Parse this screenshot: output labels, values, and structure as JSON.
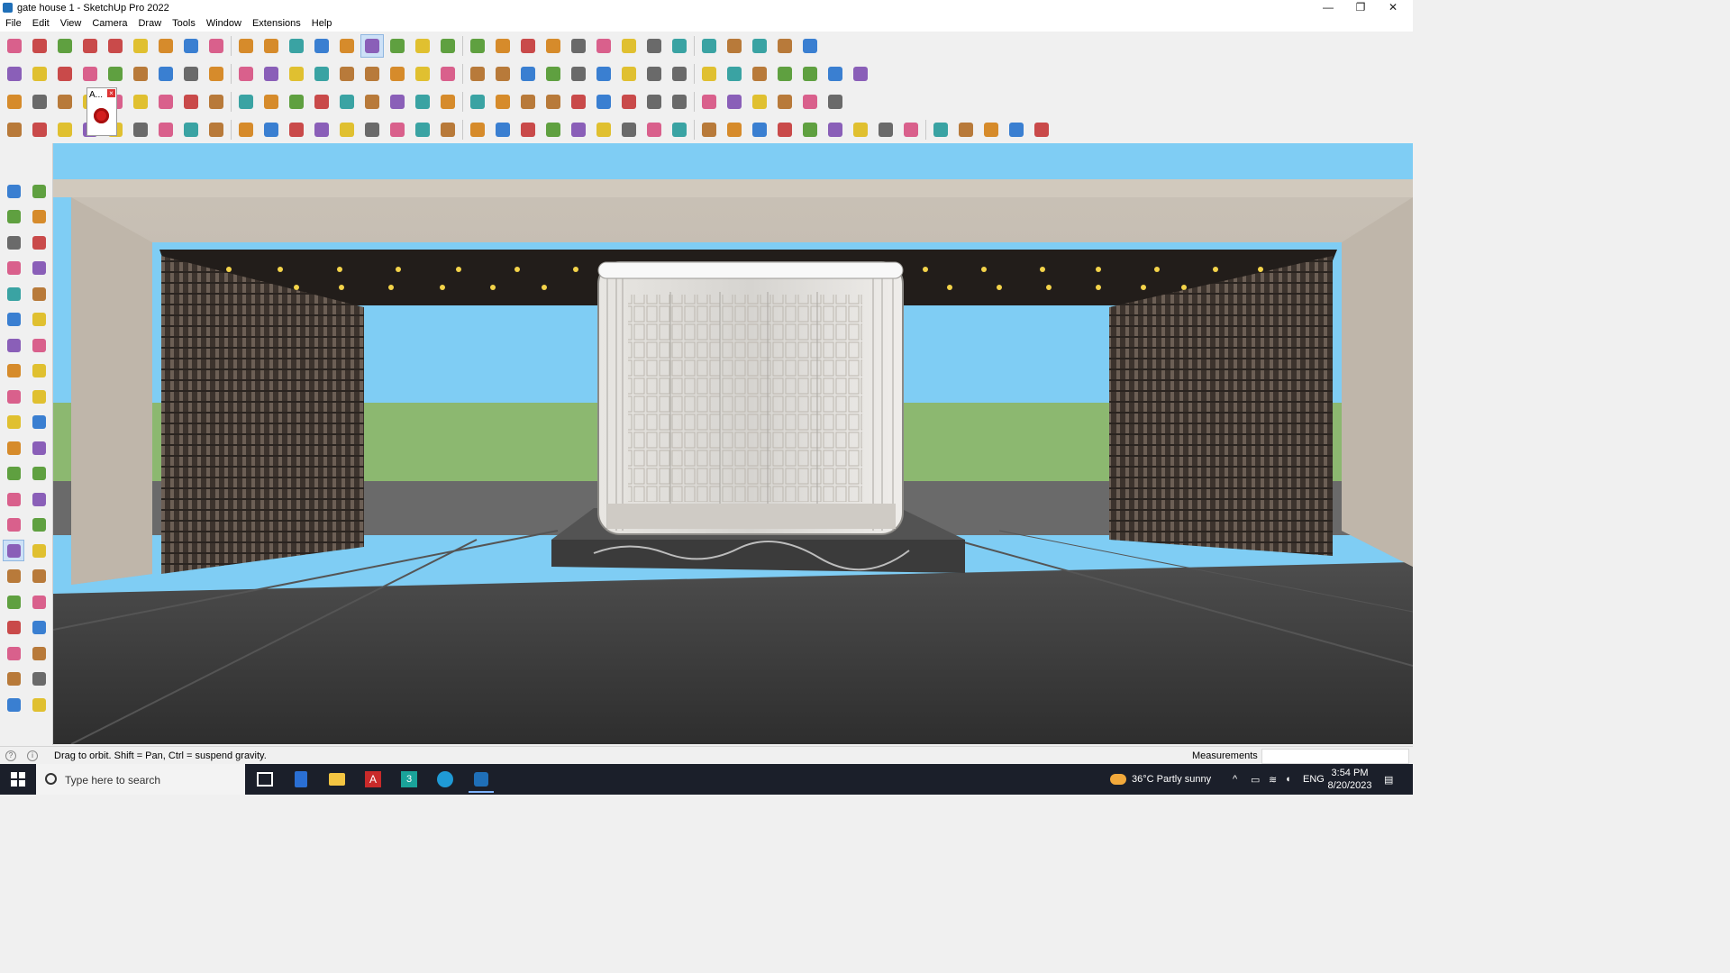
{
  "window": {
    "title": "gate house 1 - SketchUp Pro 2022",
    "controls": [
      "—",
      "❐",
      "✕"
    ]
  },
  "menu": [
    "File",
    "Edit",
    "View",
    "Camera",
    "Draw",
    "Tools",
    "Window",
    "Extensions",
    "Help"
  ],
  "toolbars": {
    "row1": [
      "zoom-extents-icon",
      "select-icon",
      "eraser-icon",
      "line-icon",
      "arc-icon",
      "shape-icon",
      "push-pull-icon",
      "follow-me-icon",
      "move-icon",
      "rotate-icon",
      "scale-icon",
      "tape-measure-icon",
      "text-icon",
      "paint-bucket-icon",
      "orbit-icon",
      "pan-icon",
      "zoom-icon",
      "zoom-window-icon",
      "model-info-icon",
      "layers-icon",
      "sandbox-icon",
      "tags-icon",
      "warehouse-icon",
      "extension-warehouse-icon",
      "layout-icon",
      "scenes-icon",
      "section-icon",
      "shadow-icon",
      "styles-icon",
      "undo-icon",
      "redo-icon",
      "print-icon"
    ],
    "row2": [
      "component-icon",
      "materials-icon",
      "solid-icon",
      "push-pull-icon",
      "axes-icon",
      "dimension-icon",
      "protractor-icon",
      "text-icon",
      "3d-text-icon",
      "section-plane-icon",
      "views-iso-icon",
      "views-top-icon",
      "views-front-icon",
      "views-right-icon",
      "views-back-icon",
      "views-left-icon",
      "standard-views-icon",
      "curve-icon",
      "offset-icon",
      "shape-icon",
      "circle-icon",
      "polygon-icon",
      "rectangle-icon",
      "arc-icon",
      "bezier-icon",
      "pencil-icon",
      "paint-icon",
      "tag-icon",
      "ruler-icon",
      "color-icon",
      "material-icon",
      "terrain-icon",
      "grid-icon",
      "plugin-icon"
    ],
    "row3": [
      "layer-icon",
      "layer-blue-icon",
      "layer-yellow-icon",
      "active-tool-popup-icon",
      "tool-red-icon",
      "fence-icon",
      "rotate-icon",
      "square-red-icon",
      "window-icon",
      "door-icon",
      "stair-icon",
      "railing-icon",
      "curve-icon",
      "move-cross-icon",
      "cross-blue-icon",
      "cone-icon",
      "pyramid-icon",
      "triangle-icon",
      "lasso-icon",
      "spiral-icon",
      "star-icon",
      "box-icon",
      "arrow-icon",
      "bag-icon",
      "gem-icon",
      "flower-icon",
      "frame-icon",
      "shade-icon",
      "grid-orange-icon",
      "grid-yellow-icon",
      "dots-icon",
      "circle-dash-icon",
      "grid-gray-icon"
    ],
    "row4": [
      "draw-icon",
      "spline-icon",
      "freehand-icon",
      "tool-1-icon",
      "tool-2-icon",
      "tool-3-icon",
      "tool-4-icon",
      "tool-5-icon",
      "tool-6-icon",
      "tool-7-icon",
      "tool-8-icon",
      "tool-9-icon",
      "tool-10-icon",
      "tool-11-icon",
      "tool-12-icon",
      "tool-13-icon",
      "tool-14-icon",
      "tool-15-icon",
      "tool-16-icon",
      "tool-17-icon",
      "tool-18-icon",
      "tool-19-icon",
      "tool-20-icon",
      "tool-21-icon",
      "tool-22-icon",
      "tool-23-icon",
      "tool-24-icon",
      "tool-25-icon",
      "tool-26-icon",
      "tool-27-icon",
      "tool-28-icon",
      "tool-29-icon",
      "tool-30-icon",
      "tool-31-icon",
      "tool-32-icon",
      "tool-33-icon",
      "tool-34-icon",
      "tool-35-icon",
      "tool-36-icon",
      "tool-37-icon",
      "tool-38-icon"
    ]
  },
  "popup_tool_label": "A...",
  "left_tools": [
    "select-icon",
    "orbit-icon",
    "paint-bucket-icon",
    "eraser-icon",
    "component-icon",
    "tape-measure-icon",
    "line-icon",
    "freehand-icon",
    "rectangle-icon",
    "rotated-rectangle-icon",
    "circle-icon",
    "polygon-icon",
    "arc-icon",
    "two-point-arc-icon",
    "pie-icon",
    "three-point-arc-icon",
    "move-icon",
    "push-pull-icon",
    "rotate-icon",
    "follow-me-icon",
    "scale-icon",
    "offset-icon",
    "tape-measure-icon",
    "dimension-icon",
    "protractor-icon",
    "text-icon",
    "axes-icon",
    "3d-text-icon",
    "orbit-icon",
    "pan-icon",
    "zoom-icon",
    "zoom-window-icon",
    "zoom-extents-icon",
    "previous-view-icon",
    "position-camera-icon",
    "look-around-icon",
    "walk-icon",
    "section-plane-icon",
    "model-info-icon",
    "tags-icon",
    "layers-icon",
    "sandbox-icon"
  ],
  "status": {
    "hint": "Drag to orbit. Shift = Pan, Ctrl = suspend gravity.",
    "measurements_label": "Measurements",
    "measurements_value": ""
  },
  "taskbar": {
    "search_placeholder": "Type here to search",
    "weather": "36°C  Partly sunny",
    "lang": "ENG",
    "time": "3:54 PM",
    "date": "8/20/2023"
  },
  "colors": {
    "sky": "#7fcdf4",
    "grass": "#8cb870",
    "ground": "#3a3a3a",
    "accent_active": "#cde1f7"
  }
}
